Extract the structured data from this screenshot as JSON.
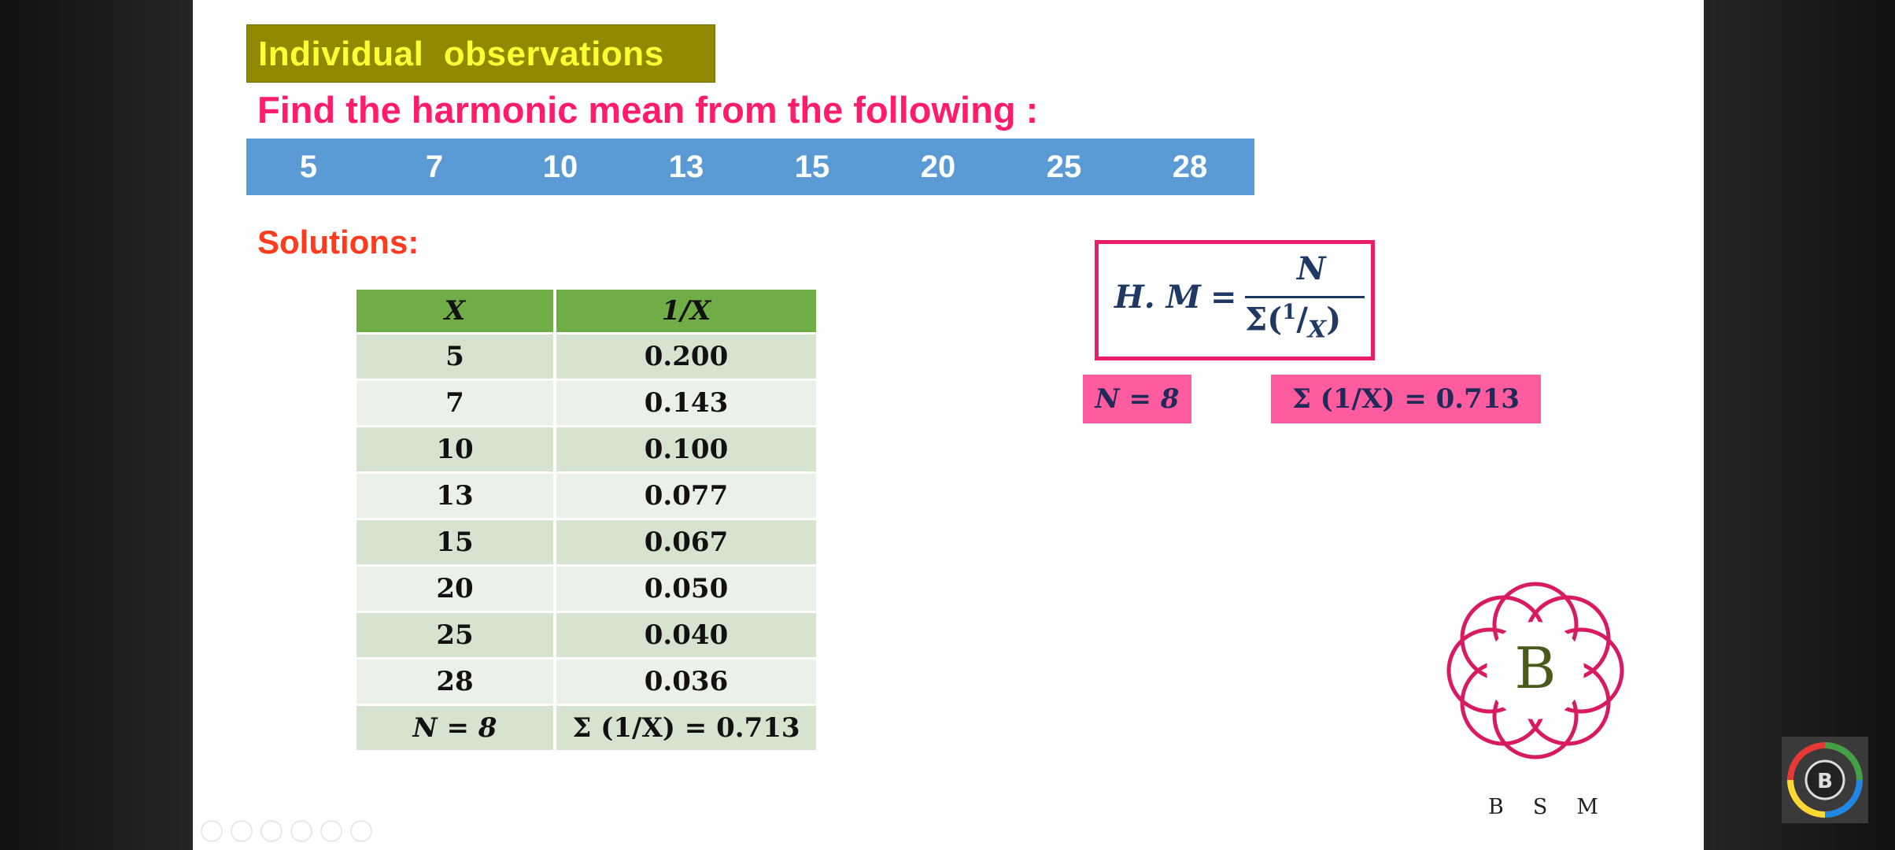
{
  "slide": {
    "title": "Individual  observations",
    "question": "Find the harmonic mean from the following :",
    "values": [
      "5",
      "7",
      "10",
      "13",
      "15",
      "20",
      "25",
      "28"
    ],
    "solutions_label": "Solutions:",
    "table": {
      "headers": [
        "X",
        "1/X"
      ],
      "rows": [
        [
          "5",
          "0.200"
        ],
        [
          "7",
          "0.143"
        ],
        [
          "10",
          "0.100"
        ],
        [
          "13",
          "0.077"
        ],
        [
          "15",
          "0.067"
        ],
        [
          "20",
          "0.050"
        ],
        [
          "25",
          "0.040"
        ],
        [
          "28",
          "0.036"
        ]
      ],
      "total": [
        "N = 8",
        "Σ (1/X) = 0.713"
      ]
    },
    "formula": {
      "lhs": "H. M",
      "equals": "=",
      "numerator": "N",
      "denominator_sigma": "Σ(",
      "denominator_one": "1",
      "denominator_slash": "/",
      "denominator_x": "X",
      "denominator_close": ")"
    },
    "n_badge": "N = 8",
    "sum_badge": "Σ (1/X) = 0.713",
    "logo": {
      "letter": "B",
      "caption": [
        "B",
        "S",
        "M"
      ],
      "color": "#d81b60"
    }
  },
  "colors": {
    "title_bg": "#8f8a00",
    "title_text": "#ffff33",
    "question_text": "#ff1d6b",
    "values_bar": "#5b9bd5",
    "table_header": "#70ad47",
    "badge_bg": "#ff5ca0"
  }
}
